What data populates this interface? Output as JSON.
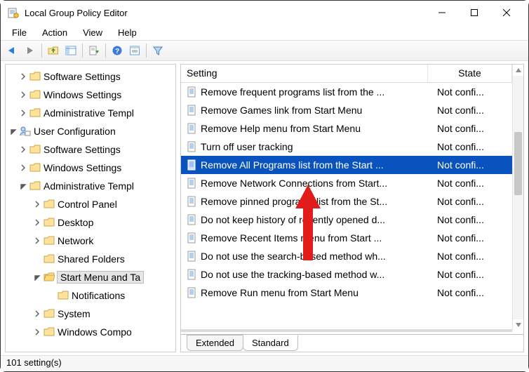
{
  "window": {
    "title": "Local Group Policy Editor"
  },
  "menus": {
    "file": "File",
    "action": "Action",
    "view": "View",
    "help": "Help"
  },
  "tree": {
    "software_settings": "Software Settings",
    "windows_settings": "Windows Settings",
    "admin_templates": "Administrative Templ",
    "user_config": "User Configuration",
    "software_settings2": "Software Settings",
    "windows_settings2": "Windows Settings",
    "admin_templates2": "Administrative Templ",
    "control_panel": "Control Panel",
    "desktop": "Desktop",
    "network": "Network",
    "shared_folders": "Shared Folders",
    "start_menu": "Start Menu and Ta",
    "notifications": "Notifications",
    "system": "System",
    "windows_compo": "Windows Compo"
  },
  "list": {
    "cols": {
      "setting": "Setting",
      "state": "State"
    },
    "rows": [
      {
        "name": "Remove frequent programs list from the ...",
        "state": "Not confi..."
      },
      {
        "name": "Remove Games link from Start Menu",
        "state": "Not confi..."
      },
      {
        "name": "Remove Help menu from Start Menu",
        "state": "Not confi..."
      },
      {
        "name": "Turn off user tracking",
        "state": "Not confi..."
      },
      {
        "name": "Remove All Programs list from the Start ...",
        "state": "Not confi..."
      },
      {
        "name": "Remove Network Connections from Start...",
        "state": "Not confi..."
      },
      {
        "name": "Remove pinned programs list from the St...",
        "state": "Not confi..."
      },
      {
        "name": "Do not keep history of recently opened d...",
        "state": "Not confi..."
      },
      {
        "name": "Remove Recent Items menu from Start ...",
        "state": "Not confi..."
      },
      {
        "name": "Do not use the search-based method wh...",
        "state": "Not confi..."
      },
      {
        "name": "Do not use the tracking-based method w...",
        "state": "Not confi..."
      },
      {
        "name": "Remove Run menu from Start Menu",
        "state": "Not confi..."
      }
    ],
    "selected_index": 4
  },
  "tabs": {
    "extended": "Extended",
    "standard": "Standard"
  },
  "status": {
    "count": "101 setting(s)"
  }
}
